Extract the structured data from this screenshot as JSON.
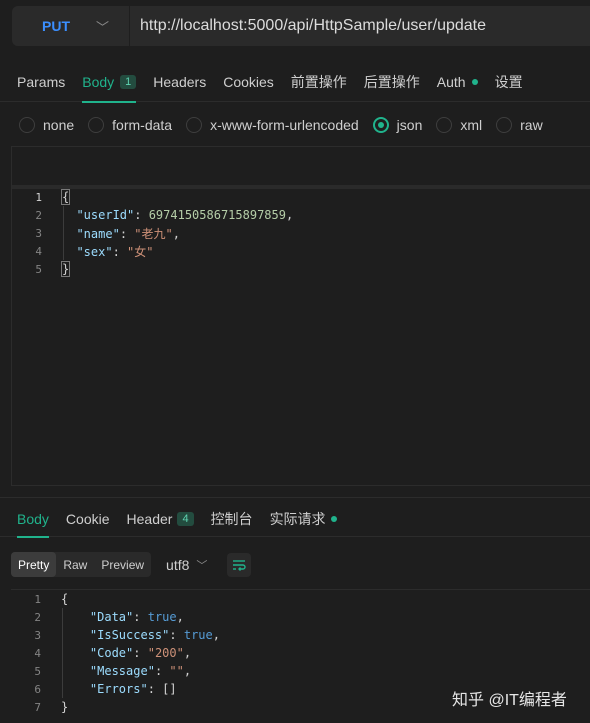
{
  "request": {
    "method": "PUT",
    "url": "http://localhost:5000/api/HttpSample/user/update",
    "tabs": [
      {
        "label": "Params"
      },
      {
        "label": "Body",
        "badge": "1",
        "active": true
      },
      {
        "label": "Headers"
      },
      {
        "label": "Cookies"
      },
      {
        "label": "前置操作"
      },
      {
        "label": "后置操作"
      },
      {
        "label": "Auth",
        "dot": true
      },
      {
        "label": "设置"
      }
    ],
    "body_types": [
      {
        "label": "none"
      },
      {
        "label": "form-data"
      },
      {
        "label": "x-www-form-urlencoded"
      },
      {
        "label": "json",
        "checked": true
      },
      {
        "label": "xml"
      },
      {
        "label": "raw"
      }
    ],
    "body_lines": [
      {
        "n": "1",
        "tokens": [
          [
            "p",
            "{"
          ]
        ]
      },
      {
        "n": "2",
        "tokens": [
          [
            "p",
            "  "
          ],
          [
            "k",
            "\"userId\""
          ],
          [
            "p",
            ": "
          ],
          [
            "n",
            "6974150586715897859"
          ],
          [
            "p",
            ","
          ]
        ]
      },
      {
        "n": "3",
        "tokens": [
          [
            "p",
            "  "
          ],
          [
            "k",
            "\"name\""
          ],
          [
            "p",
            ": "
          ],
          [
            "s",
            "\"老九\""
          ],
          [
            "p",
            ","
          ]
        ]
      },
      {
        "n": "4",
        "tokens": [
          [
            "p",
            "  "
          ],
          [
            "k",
            "\"sex\""
          ],
          [
            "p",
            ": "
          ],
          [
            "s",
            "\"女\""
          ]
        ]
      },
      {
        "n": "5",
        "tokens": [
          [
            "p",
            "}"
          ]
        ]
      }
    ]
  },
  "response": {
    "tabs": [
      {
        "label": "Body",
        "active": true
      },
      {
        "label": "Cookie"
      },
      {
        "label": "Header",
        "badge": "4"
      },
      {
        "label": "控制台"
      },
      {
        "label": "实际请求",
        "dot": true
      }
    ],
    "view_modes": [
      "Pretty",
      "Raw",
      "Preview"
    ],
    "active_view": "Pretty",
    "encoding": "utf8",
    "body_lines": [
      {
        "n": "1",
        "tokens": [
          [
            "p",
            "{"
          ]
        ]
      },
      {
        "n": "2",
        "tokens": [
          [
            "p",
            "    "
          ],
          [
            "k",
            "\"Data\""
          ],
          [
            "p",
            ": "
          ],
          [
            "b",
            "true"
          ],
          [
            "p",
            ","
          ]
        ]
      },
      {
        "n": "3",
        "tokens": [
          [
            "p",
            "    "
          ],
          [
            "k",
            "\"IsSuccess\""
          ],
          [
            "p",
            ": "
          ],
          [
            "b",
            "true"
          ],
          [
            "p",
            ","
          ]
        ]
      },
      {
        "n": "4",
        "tokens": [
          [
            "p",
            "    "
          ],
          [
            "k",
            "\"Code\""
          ],
          [
            "p",
            ": "
          ],
          [
            "s",
            "\"200\""
          ],
          [
            "p",
            ","
          ]
        ]
      },
      {
        "n": "5",
        "tokens": [
          [
            "p",
            "    "
          ],
          [
            "k",
            "\"Message\""
          ],
          [
            "p",
            ": "
          ],
          [
            "s",
            "\"\""
          ],
          [
            "p",
            ","
          ]
        ]
      },
      {
        "n": "6",
        "tokens": [
          [
            "p",
            "    "
          ],
          [
            "k",
            "\"Errors\""
          ],
          [
            "p",
            ": []"
          ]
        ]
      },
      {
        "n": "7",
        "tokens": [
          [
            "p",
            "}"
          ]
        ]
      }
    ]
  },
  "watermark": "知乎 @IT编程者",
  "colors": {
    "accent": "#20b38c",
    "method": "#3b8fff",
    "background": "#1e1e1e"
  }
}
